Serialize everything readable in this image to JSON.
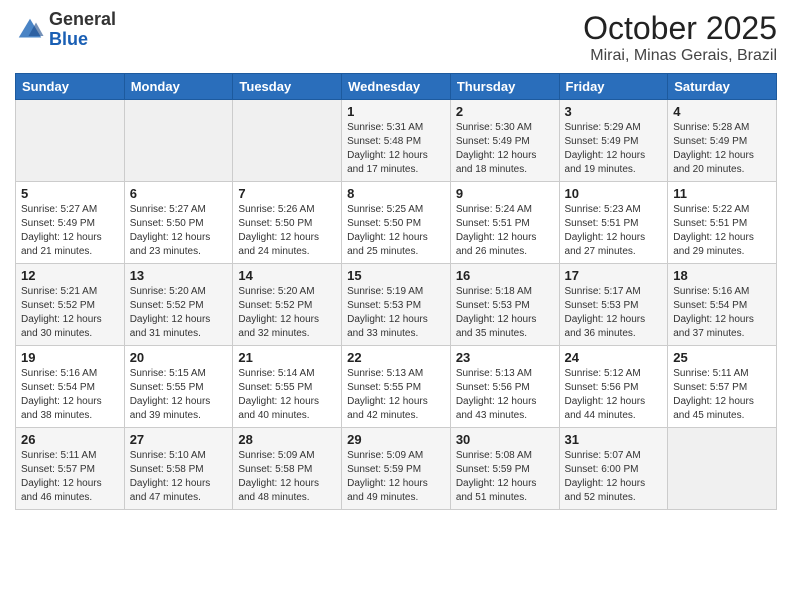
{
  "header": {
    "logo_general": "General",
    "logo_blue": "Blue",
    "month": "October 2025",
    "location": "Mirai, Minas Gerais, Brazil"
  },
  "weekdays": [
    "Sunday",
    "Monday",
    "Tuesday",
    "Wednesday",
    "Thursday",
    "Friday",
    "Saturday"
  ],
  "weeks": [
    [
      {
        "day": "",
        "info": ""
      },
      {
        "day": "",
        "info": ""
      },
      {
        "day": "",
        "info": ""
      },
      {
        "day": "1",
        "info": "Sunrise: 5:31 AM\nSunset: 5:48 PM\nDaylight: 12 hours\nand 17 minutes."
      },
      {
        "day": "2",
        "info": "Sunrise: 5:30 AM\nSunset: 5:49 PM\nDaylight: 12 hours\nand 18 minutes."
      },
      {
        "day": "3",
        "info": "Sunrise: 5:29 AM\nSunset: 5:49 PM\nDaylight: 12 hours\nand 19 minutes."
      },
      {
        "day": "4",
        "info": "Sunrise: 5:28 AM\nSunset: 5:49 PM\nDaylight: 12 hours\nand 20 minutes."
      }
    ],
    [
      {
        "day": "5",
        "info": "Sunrise: 5:27 AM\nSunset: 5:49 PM\nDaylight: 12 hours\nand 21 minutes."
      },
      {
        "day": "6",
        "info": "Sunrise: 5:27 AM\nSunset: 5:50 PM\nDaylight: 12 hours\nand 23 minutes."
      },
      {
        "day": "7",
        "info": "Sunrise: 5:26 AM\nSunset: 5:50 PM\nDaylight: 12 hours\nand 24 minutes."
      },
      {
        "day": "8",
        "info": "Sunrise: 5:25 AM\nSunset: 5:50 PM\nDaylight: 12 hours\nand 25 minutes."
      },
      {
        "day": "9",
        "info": "Sunrise: 5:24 AM\nSunset: 5:51 PM\nDaylight: 12 hours\nand 26 minutes."
      },
      {
        "day": "10",
        "info": "Sunrise: 5:23 AM\nSunset: 5:51 PM\nDaylight: 12 hours\nand 27 minutes."
      },
      {
        "day": "11",
        "info": "Sunrise: 5:22 AM\nSunset: 5:51 PM\nDaylight: 12 hours\nand 29 minutes."
      }
    ],
    [
      {
        "day": "12",
        "info": "Sunrise: 5:21 AM\nSunset: 5:52 PM\nDaylight: 12 hours\nand 30 minutes."
      },
      {
        "day": "13",
        "info": "Sunrise: 5:20 AM\nSunset: 5:52 PM\nDaylight: 12 hours\nand 31 minutes."
      },
      {
        "day": "14",
        "info": "Sunrise: 5:20 AM\nSunset: 5:52 PM\nDaylight: 12 hours\nand 32 minutes."
      },
      {
        "day": "15",
        "info": "Sunrise: 5:19 AM\nSunset: 5:53 PM\nDaylight: 12 hours\nand 33 minutes."
      },
      {
        "day": "16",
        "info": "Sunrise: 5:18 AM\nSunset: 5:53 PM\nDaylight: 12 hours\nand 35 minutes."
      },
      {
        "day": "17",
        "info": "Sunrise: 5:17 AM\nSunset: 5:53 PM\nDaylight: 12 hours\nand 36 minutes."
      },
      {
        "day": "18",
        "info": "Sunrise: 5:16 AM\nSunset: 5:54 PM\nDaylight: 12 hours\nand 37 minutes."
      }
    ],
    [
      {
        "day": "19",
        "info": "Sunrise: 5:16 AM\nSunset: 5:54 PM\nDaylight: 12 hours\nand 38 minutes."
      },
      {
        "day": "20",
        "info": "Sunrise: 5:15 AM\nSunset: 5:55 PM\nDaylight: 12 hours\nand 39 minutes."
      },
      {
        "day": "21",
        "info": "Sunrise: 5:14 AM\nSunset: 5:55 PM\nDaylight: 12 hours\nand 40 minutes."
      },
      {
        "day": "22",
        "info": "Sunrise: 5:13 AM\nSunset: 5:55 PM\nDaylight: 12 hours\nand 42 minutes."
      },
      {
        "day": "23",
        "info": "Sunrise: 5:13 AM\nSunset: 5:56 PM\nDaylight: 12 hours\nand 43 minutes."
      },
      {
        "day": "24",
        "info": "Sunrise: 5:12 AM\nSunset: 5:56 PM\nDaylight: 12 hours\nand 44 minutes."
      },
      {
        "day": "25",
        "info": "Sunrise: 5:11 AM\nSunset: 5:57 PM\nDaylight: 12 hours\nand 45 minutes."
      }
    ],
    [
      {
        "day": "26",
        "info": "Sunrise: 5:11 AM\nSunset: 5:57 PM\nDaylight: 12 hours\nand 46 minutes."
      },
      {
        "day": "27",
        "info": "Sunrise: 5:10 AM\nSunset: 5:58 PM\nDaylight: 12 hours\nand 47 minutes."
      },
      {
        "day": "28",
        "info": "Sunrise: 5:09 AM\nSunset: 5:58 PM\nDaylight: 12 hours\nand 48 minutes."
      },
      {
        "day": "29",
        "info": "Sunrise: 5:09 AM\nSunset: 5:59 PM\nDaylight: 12 hours\nand 49 minutes."
      },
      {
        "day": "30",
        "info": "Sunrise: 5:08 AM\nSunset: 5:59 PM\nDaylight: 12 hours\nand 51 minutes."
      },
      {
        "day": "31",
        "info": "Sunrise: 5:07 AM\nSunset: 6:00 PM\nDaylight: 12 hours\nand 52 minutes."
      },
      {
        "day": "",
        "info": ""
      }
    ]
  ]
}
